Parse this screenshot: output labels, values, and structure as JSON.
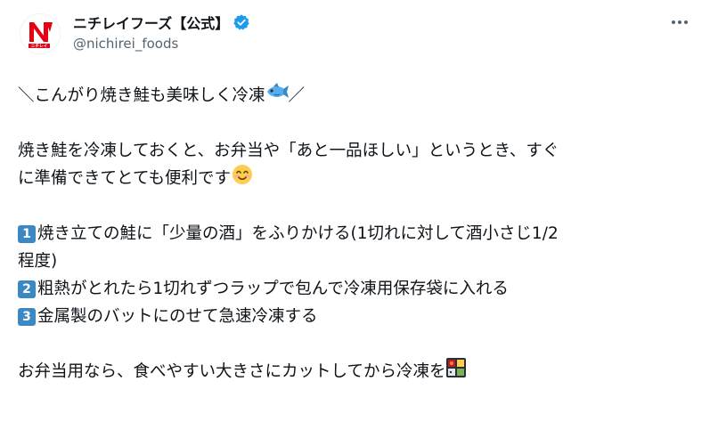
{
  "account": {
    "display_name": "ニチレイフーズ【公式】",
    "handle": "@nichirei_foods",
    "avatar_logo_text": "ニチレイ",
    "verified": true
  },
  "icons": {
    "verified": "verified-badge-icon",
    "more": "more-options-icon",
    "fish": "fish-emoji",
    "smile": "smiling-face-emoji",
    "bento": "bento-box-emoji"
  },
  "colors": {
    "brand_red": "#e60012",
    "verified_blue": "#1d9bf0",
    "keycap_blue": "#3b88c3",
    "text": "#0f1419",
    "muted": "#536471"
  },
  "tweet": {
    "headline": "＼こんがり焼き鮭も美味しく冷凍",
    "headline_end": "／",
    "intro_line1": "焼き鮭を冷凍しておくと、お弁当や「あと一品ほしい」というとき、すぐ",
    "intro_line2": "に準備できてとても便利です",
    "steps": [
      {
        "num": "1",
        "text_line1": "焼き立ての鮭に「少量の酒」をふりかける(1切れに対して酒小さじ1/2",
        "text_line2": "程度)"
      },
      {
        "num": "2",
        "text_line1": "粗熱がとれたら1切れずつラップで包んで冷凍用保存袋に入れる"
      },
      {
        "num": "3",
        "text_line1": "金属製のバットにのせて急速冷凍する"
      }
    ],
    "closing": "お弁当用なら、食べやすい大きさにカットしてから冷凍を"
  }
}
